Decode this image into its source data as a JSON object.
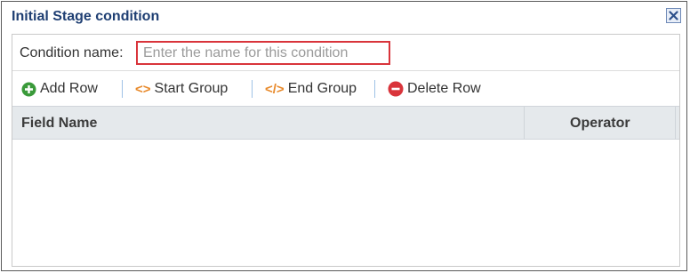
{
  "dialog": {
    "title": "Initial Stage condition",
    "close_icon": "close-icon"
  },
  "condition": {
    "label": "Condition name:",
    "placeholder": "Enter the name for this condition",
    "value": ""
  },
  "toolbar": {
    "add_row": "Add Row",
    "start_group_icon": "<>",
    "start_group": "Start Group",
    "end_group_icon": "</>",
    "end_group": "End Group",
    "delete_row": "Delete Row"
  },
  "grid": {
    "columns": [
      "Field Name",
      "Operator"
    ],
    "rows": []
  },
  "colors": {
    "title": "#1f3f73",
    "add_icon": "#3a9a3a",
    "group_icon": "#e8892a",
    "delete_icon": "#d9343b",
    "input_border": "#d9343b",
    "header_bg": "#e5e9ec"
  }
}
